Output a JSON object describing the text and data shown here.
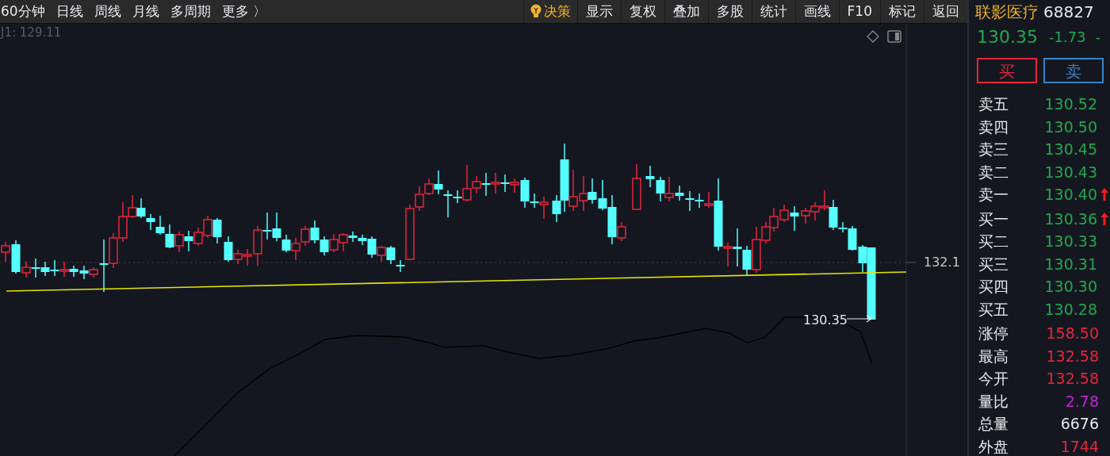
{
  "toolbar": {
    "periods": [
      "60分钟",
      "日线",
      "周线",
      "月线",
      "多周期",
      "更多 〉"
    ],
    "decision": "决策",
    "tools": [
      "显示",
      "复权",
      "叠加",
      "多股",
      "统计",
      "画线",
      "F10",
      "标记",
      "返回"
    ]
  },
  "chart": {
    "indicator_label": "J1: 129.11",
    "axis_label": "132.1",
    "last_price_label": "130.35"
  },
  "quote": {
    "name": "联影医疗",
    "code": "68827",
    "price": "130.35",
    "change": "-1.73",
    "change_pct": "-"
  },
  "trade_buttons": [
    {
      "label": "买",
      "kind": "buy"
    },
    {
      "label": "卖",
      "kind": "sell"
    }
  ],
  "asks": [
    {
      "label": "卖五",
      "price": "130.52",
      "arrow": false
    },
    {
      "label": "卖四",
      "price": "130.50",
      "arrow": false
    },
    {
      "label": "卖三",
      "price": "130.45",
      "arrow": false
    },
    {
      "label": "卖二",
      "price": "130.43",
      "arrow": false
    },
    {
      "label": "卖一",
      "price": "130.40",
      "arrow": true
    }
  ],
  "bids": [
    {
      "label": "买一",
      "price": "130.36",
      "arrow": true
    },
    {
      "label": "买二",
      "price": "130.33",
      "arrow": false
    },
    {
      "label": "买三",
      "price": "130.31",
      "arrow": false
    },
    {
      "label": "买四",
      "price": "130.30",
      "arrow": false
    },
    {
      "label": "买五",
      "price": "130.28",
      "arrow": false
    }
  ],
  "stats": [
    {
      "label": "涨停",
      "value": "158.50",
      "color": "#e8243c"
    },
    {
      "label": "最高",
      "value": "132.58",
      "color": "#e8243c"
    },
    {
      "label": "今开",
      "value": "132.58",
      "color": "#e8243c"
    },
    {
      "label": "量比",
      "value": "2.78",
      "color": "#c026d3"
    },
    {
      "label": "总量",
      "value": "6676",
      "color": "#e5e7eb"
    },
    {
      "label": "外盘",
      "value": "1744",
      "color": "#e8243c"
    }
  ]
}
